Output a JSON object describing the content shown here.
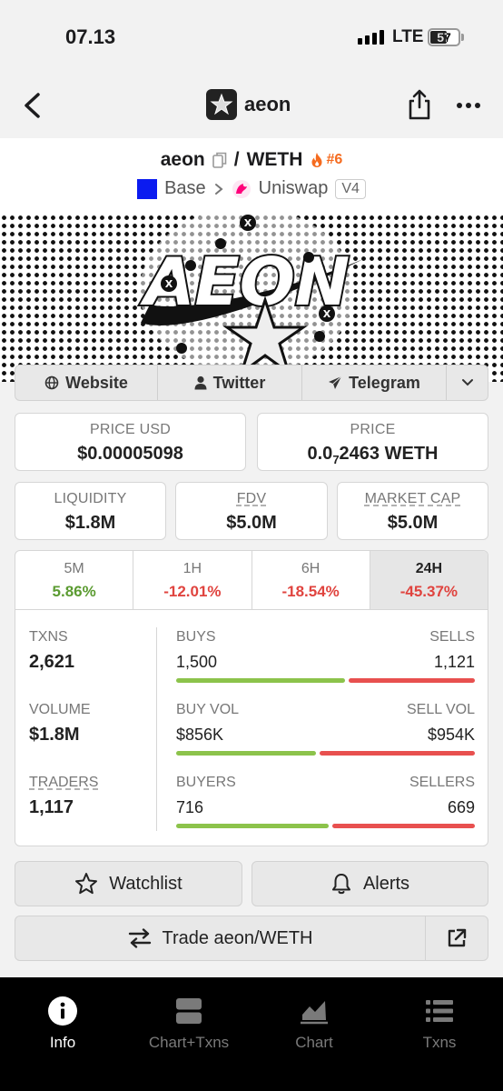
{
  "status": {
    "time": "07.13",
    "network": "LTE",
    "battery": "57",
    "battery_level": 0.57
  },
  "nav": {
    "title": "aeon"
  },
  "pair": {
    "base": "aeon",
    "separator": "/",
    "quote": "WETH",
    "rank": "#6",
    "chain": "Base",
    "dex": "Uniswap",
    "version": "V4",
    "chain_color": "#0b1bf0"
  },
  "links": {
    "website": "Website",
    "twitter": "Twitter",
    "telegram": "Telegram"
  },
  "price": {
    "usd_label": "PRICE USD",
    "usd_value": "$0.00005098",
    "native_label": "PRICE",
    "native_prefix": "0.0",
    "native_zeros": "7",
    "native_rest": "2463 WETH"
  },
  "metrics": {
    "liquidity_label": "LIQUIDITY",
    "liquidity_value": "$1.8M",
    "fdv_label": "FDV",
    "fdv_value": "$5.0M",
    "mcap_label": "MARKET CAP",
    "mcap_value": "$5.0M"
  },
  "timeframes": [
    {
      "label": "5M",
      "value": "5.86%"
    },
    {
      "label": "1H",
      "value": "-12.01%"
    },
    {
      "label": "6H",
      "value": "-18.54%"
    },
    {
      "label": "24H",
      "value": "-45.37%"
    }
  ],
  "stats": {
    "txns_label": "TXNS",
    "txns_value": "2,621",
    "volume_label": "VOLUME",
    "volume_value": "$1.8M",
    "traders_label": "TRADERS",
    "traders_value": "1,117",
    "buys_label": "BUYS",
    "buys_value": "1,500",
    "sells_label": "SELLS",
    "sells_value": "1,121",
    "buys_fraction": 0.572,
    "buyvol_label": "BUY VOL",
    "buyvol_value": "$856K",
    "sellvol_label": "SELL VOL",
    "sellvol_value": "$954K",
    "buyvol_fraction": 0.473,
    "buyers_label": "BUYERS",
    "buyers_value": "716",
    "sellers_label": "SELLERS",
    "sellers_value": "669",
    "buyers_fraction": 0.517
  },
  "actions": {
    "watchlist": "Watchlist",
    "alerts": "Alerts",
    "trade": "Trade aeon/WETH"
  },
  "tabs": [
    {
      "label": "Info"
    },
    {
      "label": "Chart+Txns"
    },
    {
      "label": "Chart"
    },
    {
      "label": "Txns"
    }
  ],
  "colors": {
    "positive": "#5b9b31",
    "negative": "#e0443f",
    "buy_bar": "#8cc34b",
    "sell_bar": "#e8504f"
  }
}
